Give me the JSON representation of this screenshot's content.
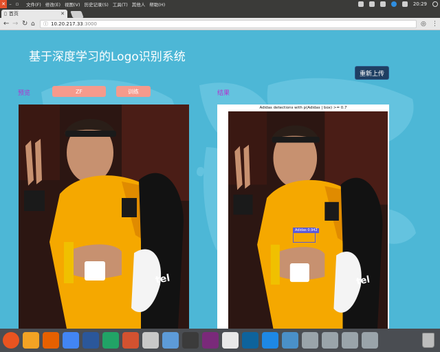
{
  "system_bar": {
    "menus": [
      "文件(F)",
      "修改(E)",
      "视图(V)",
      "历史记录(S)",
      "工具(T)",
      "其他人",
      "帮助(H)"
    ],
    "clock": "20:29"
  },
  "browser": {
    "tab_title": "首页",
    "url_host": "10.20.217.33",
    "url_port": ":3000"
  },
  "page": {
    "title": "基于深度学习的Logo识别系统",
    "reupload_button": "重新上传",
    "preview_label": "预览",
    "input_value": "ZF",
    "train_button": "训练",
    "result_label": "结果",
    "result_caption": "Adidas detections with p(Adidas | box) >= 0.7",
    "detection_label": "Adidas 0.942"
  },
  "dock": {
    "apps": [
      "ubuntu-icon",
      "files-icon",
      "firefox-icon",
      "chromium-icon",
      "writer-icon",
      "spreadsheet-icon",
      "presentation-icon",
      "software-icon",
      "screenshot-icon",
      "terminal-icon",
      "monitor-icon",
      "flask-icon",
      "vscode-icon",
      "browser-icon",
      "desktop-icon",
      "window-icon",
      "window-icon",
      "window-icon",
      "window-icon"
    ],
    "colors": [
      "#e95420",
      "#f3a324",
      "#e66000",
      "#4285f4",
      "#2b579a",
      "#21a366",
      "#d35230",
      "#c8c8c8",
      "#5d9bd8",
      "#3b3b3b",
      "#7a2a7a",
      "#e8e8e8",
      "#0e639c",
      "#1e88e5",
      "#4a90c8",
      "#9aa4aa",
      "#9aa4aa",
      "#9aa4aa",
      "#9aa4aa"
    ]
  }
}
